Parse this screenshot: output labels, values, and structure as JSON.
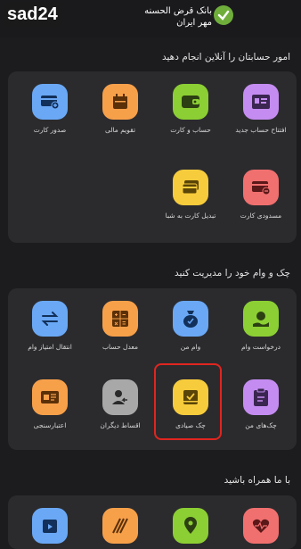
{
  "watermark": "sad24",
  "brand": {
    "line1": "بانک قرض الحسنه",
    "line2": "مهر ایران"
  },
  "colors": {
    "background": "#1c1c1f",
    "card": "#2b2b2e",
    "purple": "#c48cf0",
    "green": "#8ccf34",
    "orange": "#f7a04a",
    "blue": "#6aa8f5",
    "red": "#f0706f",
    "yellow": "#f7cc3c",
    "gray": "#a8a8a8",
    "highlight": "#e0251f"
  },
  "section1": {
    "title": "امور حسابتان را آنلاین انجام دهید",
    "items": [
      {
        "label": "افتتاح حساب جدید",
        "icon": "id-card-icon"
      },
      {
        "label": "حساب و کارت",
        "icon": "wallet-icon"
      },
      {
        "label": "تقویم مالی",
        "icon": "calendar-icon"
      },
      {
        "label": "صدور کارت",
        "icon": "card-plus-icon"
      },
      {
        "label": "مسدودی کارت",
        "icon": "card-block-icon"
      },
      {
        "label": "تبدیل کارت به شبا",
        "icon": "card-convert-icon"
      }
    ]
  },
  "section2": {
    "title": "چک و وام خود را مدیریت کنید",
    "items": [
      {
        "label": "درخواست وام",
        "icon": "loan-request-icon"
      },
      {
        "label": "وام من",
        "icon": "money-bag-icon"
      },
      {
        "label": "معدل حساب",
        "icon": "calculator-icon"
      },
      {
        "label": "انتقال امتیاز وام",
        "icon": "transfer-arrows-icon"
      },
      {
        "label": "چک‌های من",
        "icon": "clipboard-icon"
      },
      {
        "label": "چک صیادی",
        "icon": "cheque-book-icon"
      },
      {
        "label": "اقساط دیگران",
        "icon": "person-arrow-icon"
      },
      {
        "label": "اعتبارسنجی",
        "icon": "credit-check-icon"
      }
    ]
  },
  "section3": {
    "title": "با ما همراه باشید",
    "items": [
      {
        "icon": "heart-pulse-icon"
      },
      {
        "icon": "location-pin-icon"
      },
      {
        "icon": "striped-icon"
      },
      {
        "icon": "video-calendar-icon"
      }
    ]
  }
}
